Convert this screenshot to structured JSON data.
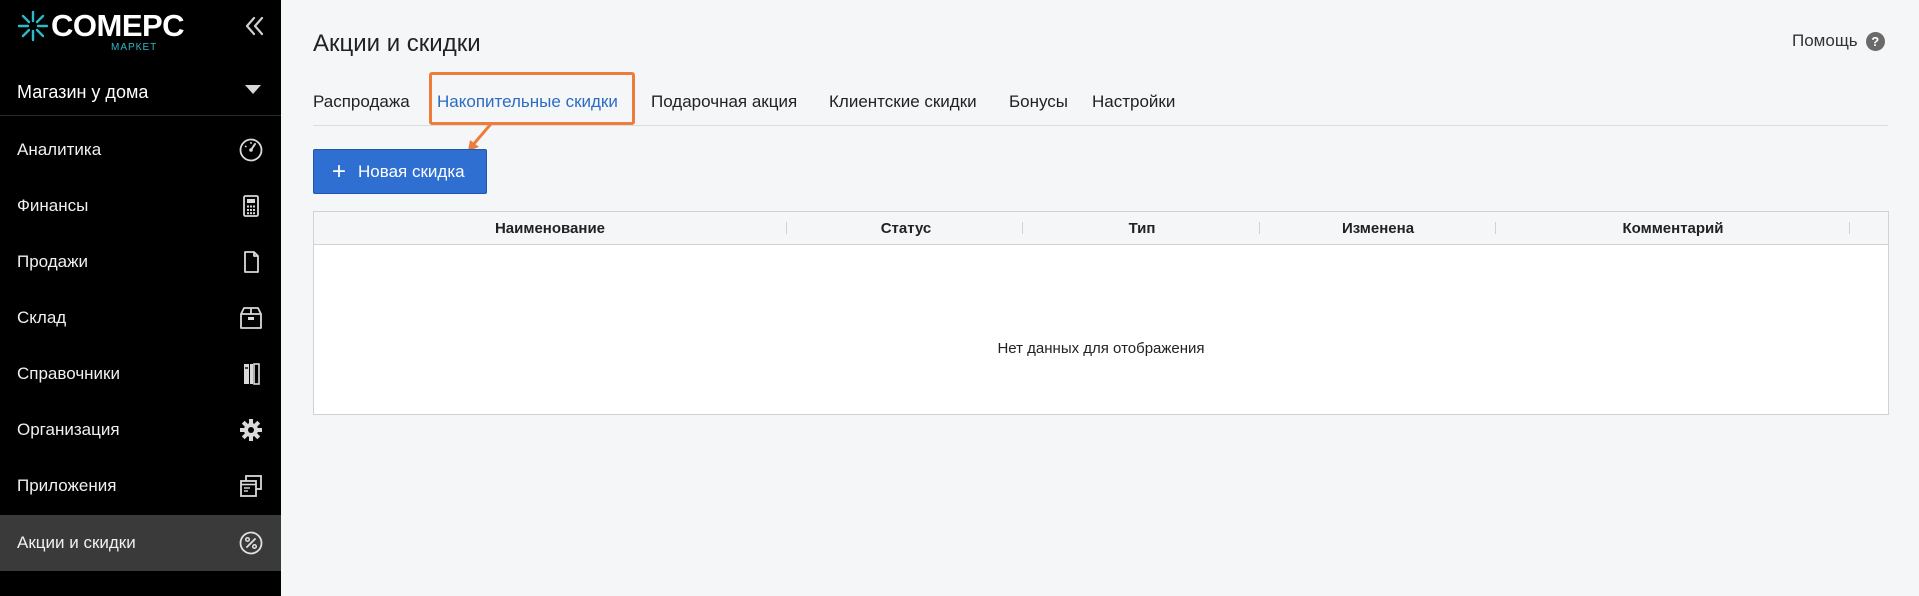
{
  "brand": {
    "name": "COMEPC",
    "sub": "МАРКЕТ"
  },
  "store": {
    "name": "Магазин у дома"
  },
  "sidebar": {
    "items": [
      {
        "label": "Аналитика",
        "icon": "gauge-icon"
      },
      {
        "label": "Финансы",
        "icon": "calculator-icon"
      },
      {
        "label": "Продажи",
        "icon": "document-icon"
      },
      {
        "label": "Склад",
        "icon": "box-icon"
      },
      {
        "label": "Справочники",
        "icon": "book-icon"
      },
      {
        "label": "Организация",
        "icon": "gear-icon"
      },
      {
        "label": "Приложения",
        "icon": "windows-icon"
      },
      {
        "label": "Акции и скидки",
        "icon": "percent-icon",
        "active": true
      }
    ]
  },
  "header": {
    "title": "Акции и скидки",
    "help_label": "Помощь",
    "help_icon": "?"
  },
  "tabs": [
    {
      "label": "Распродажа"
    },
    {
      "label": "Накопительные скидки",
      "active": true
    },
    {
      "label": "Подарочная акция"
    },
    {
      "label": "Клиентские скидки"
    },
    {
      "label": "Бонусы"
    },
    {
      "label": "Настройки"
    }
  ],
  "toolbar": {
    "new_label": "Новая скидка",
    "plus": "+"
  },
  "table": {
    "columns": [
      "Наименование",
      "Статус",
      "Тип",
      "Изменена",
      "Комментарий"
    ],
    "empty_text": "Нет данных для отображения"
  },
  "colors": {
    "accent": "#2f6fd1",
    "highlight": "#f07c3c",
    "sidebar_bg": "#000000",
    "active_tab": "#2b6cc4"
  }
}
